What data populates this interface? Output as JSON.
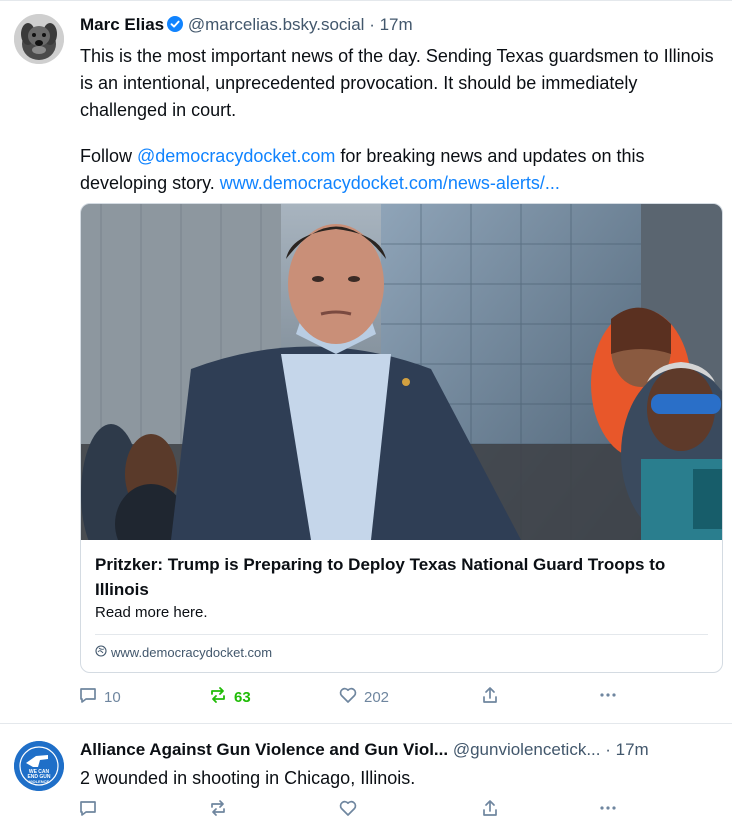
{
  "post1": {
    "author_name": "Marc Elias",
    "handle": "@marcelias.bsky.social",
    "separator": "·",
    "time": "17m",
    "text_para1": "This is the most important news of the day. Sending Texas guardsmen to Illinois is an intentional, unprecedented provocation. It should be immediately challenged in court.",
    "text_follow": "Follow ",
    "mention": "@democracydocket.com",
    "text_middle": " for breaking news and updates on this developing story. ",
    "url_link": "www.democracydocket.com/news-alerts/...",
    "card": {
      "title": "Pritzker: Trump is Preparing to Deploy Texas National Guard Troops to Illinois",
      "description": "Read more here.",
      "domain": "www.democracydocket.com"
    },
    "actions": {
      "reply_count": "10",
      "repost_count": "63",
      "like_count": "202"
    }
  },
  "post2": {
    "author_name": "Alliance Against Gun Violence and Gun Viol...",
    "handle": "@gunviolencetick...",
    "separator": "·",
    "time": "17m",
    "text": "2 wounded in shooting in Chicago, Illinois.",
    "avatar_text": "WE CAN END GUN VIOLENCE"
  },
  "colors": {
    "link": "#1083fe",
    "reposted": "#20bc07",
    "muted": "#42576c",
    "verified": "#1083fe"
  },
  "icons": [
    "reply-icon",
    "repost-icon",
    "like-icon",
    "share-icon",
    "more-icon",
    "verified-icon",
    "globe-icon"
  ]
}
